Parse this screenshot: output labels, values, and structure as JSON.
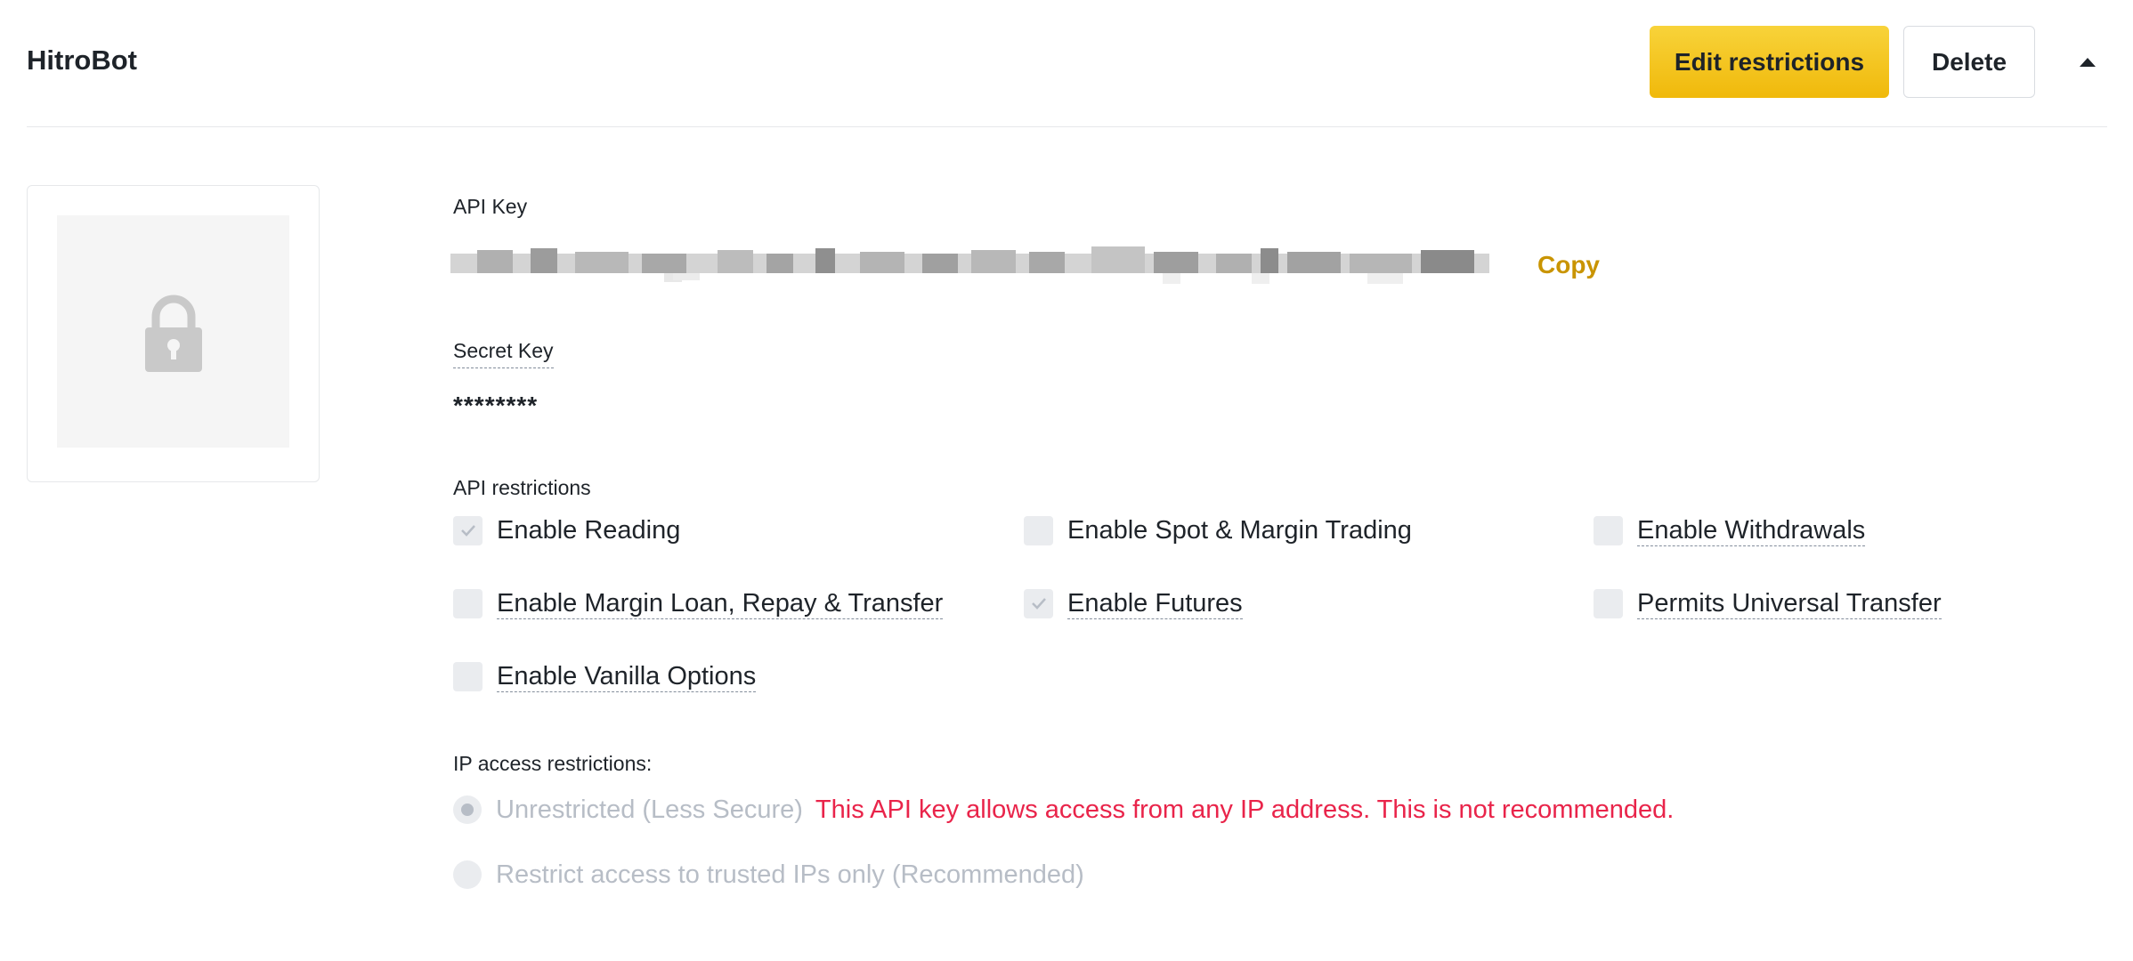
{
  "header": {
    "title": "HitroBot",
    "edit_label": "Edit restrictions",
    "delete_label": "Delete",
    "collapse_icon": "caret-up-icon"
  },
  "image_card": {
    "icon": "lock-icon"
  },
  "api_key": {
    "label": "API Key",
    "copy_label": "Copy"
  },
  "secret_key": {
    "label": "Secret Key",
    "value": "********"
  },
  "restrictions": {
    "label": "API restrictions",
    "items": [
      {
        "label": "Enable Reading",
        "checked": true
      },
      {
        "label": "Enable Spot & Margin Trading",
        "checked": false
      },
      {
        "label": "Enable Withdrawals",
        "checked": false
      },
      {
        "label": "Enable Margin Loan, Repay & Transfer",
        "checked": false
      },
      {
        "label": "Enable Futures",
        "checked": true
      },
      {
        "label": "Permits Universal Transfer",
        "checked": false
      },
      {
        "label": "Enable Vanilla Options",
        "checked": false
      }
    ]
  },
  "ip": {
    "label": "IP access restrictions:",
    "unrestricted_label": "Unrestricted (Less Secure)",
    "warning": "This API key allows access from any IP address. This is not recommended.",
    "trusted_label": "Restrict access to trusted IPs only (Recommended)",
    "selected": "unrestricted"
  },
  "colors": {
    "accent": "#f0b90b",
    "copy": "#c99400",
    "warning": "#e9244a",
    "disabled_text": "#b7bdc6"
  }
}
